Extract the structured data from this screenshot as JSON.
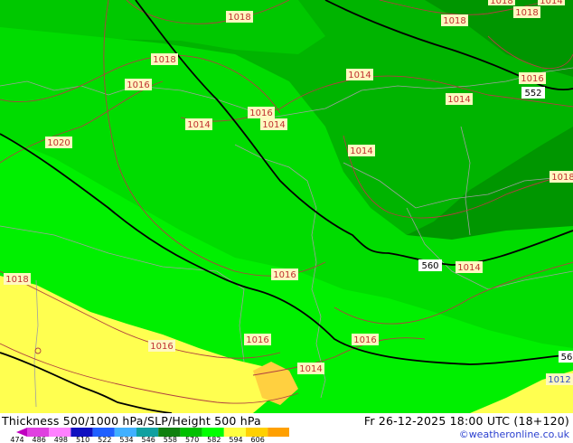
{
  "header": {
    "title": "Thickness 500/1000 hPa/SLP/Height 500 hPa",
    "datetime": "Fr 26-12-2025 18:00 UTC (18+120)",
    "credit": "©weatheronline.co.uk"
  },
  "legend": {
    "ticks": [
      "474",
      "486",
      "498",
      "510",
      "522",
      "534",
      "546",
      "558",
      "570",
      "582",
      "594",
      "606"
    ],
    "colors": [
      "#c000c0",
      "#e040e0",
      "#ff80ff",
      "#1010c0",
      "#2060ff",
      "#40b0ff",
      "#10a0a0",
      "#108010",
      "#00c000",
      "#00ff00",
      "#ffff40",
      "#ffd000",
      "#ffa000"
    ]
  },
  "thickness_colors": {
    "dark_green": "#009600",
    "green": "#00b400",
    "mid_green": "#00c800",
    "bright_green": "#00dc00",
    "light_green": "#00f000",
    "yellow": "#ffff50",
    "orange": "#ffd040"
  },
  "isobars": [
    {
      "text": "1018"
    },
    {
      "text": "1018"
    },
    {
      "text": "1018"
    },
    {
      "text": "1018"
    },
    {
      "text": "1018"
    },
    {
      "text": "1014"
    },
    {
      "text": "1016"
    },
    {
      "text": "1016"
    },
    {
      "text": "1020"
    },
    {
      "text": "1014"
    },
    {
      "text": "1016"
    },
    {
      "text": "1014"
    },
    {
      "text": "1014"
    },
    {
      "text": "1014"
    },
    {
      "text": "1014"
    },
    {
      "text": "1016"
    },
    {
      "text": "1016"
    },
    {
      "text": "1016"
    },
    {
      "text": "1016"
    },
    {
      "text": "1014"
    },
    {
      "text": "1014"
    },
    {
      "text": "1018"
    },
    {
      "text": "1018"
    },
    {
      "text": "1012"
    }
  ],
  "heights": [
    {
      "text": "552"
    },
    {
      "text": "560"
    },
    {
      "text": "56"
    }
  ]
}
